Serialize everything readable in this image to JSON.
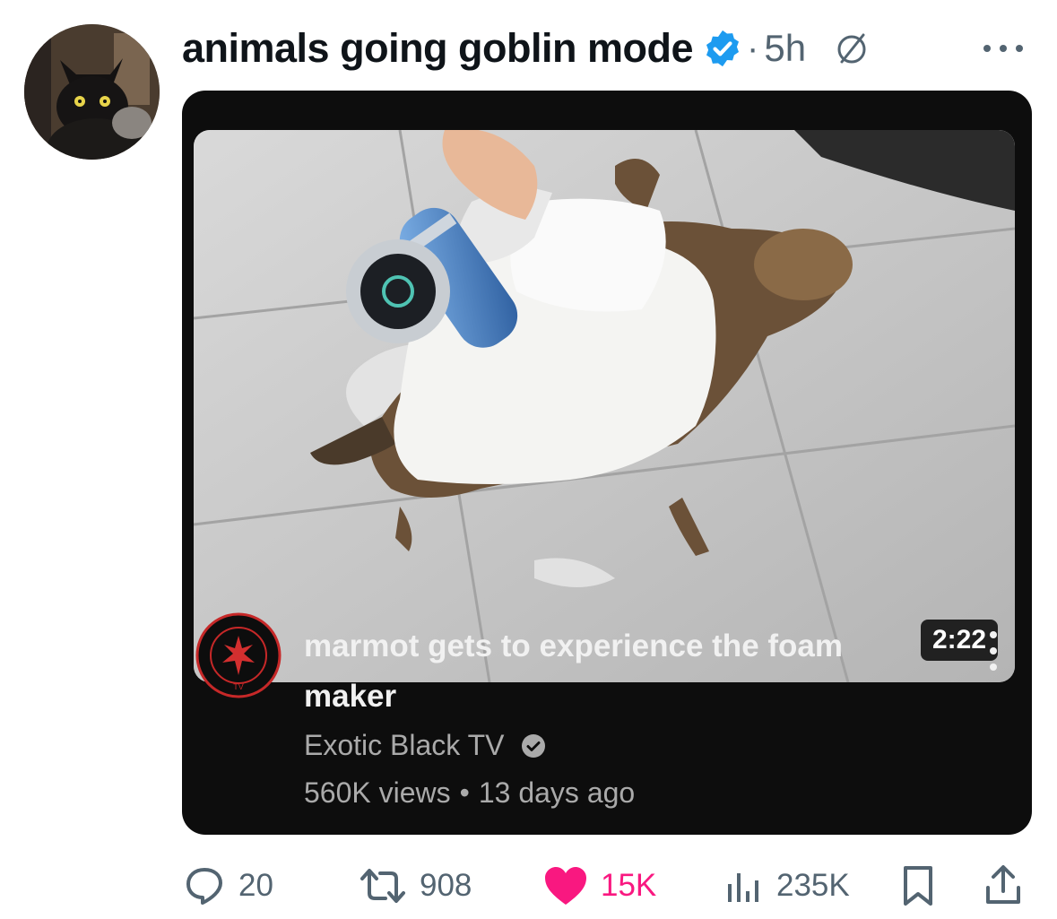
{
  "post": {
    "author_name": "animals going goblin mode",
    "separator": "·",
    "timestamp": "5h"
  },
  "video_card": {
    "duration": "2:22",
    "title": "marmot gets to experience the foam maker",
    "channel_name": "Exotic Black TV",
    "views": "560K views",
    "meta_separator": "•",
    "age": "13 days ago"
  },
  "actions": {
    "replies": "20",
    "reposts": "908",
    "likes": "15K",
    "views": "235K"
  },
  "icons": {
    "verified": "verified-badge-icon",
    "grok": "grok-icon",
    "more": "more-horizontal-icon",
    "reply": "reply-icon",
    "repost": "repost-icon",
    "like": "heart-icon",
    "views": "views-bar-icon",
    "bookmark": "bookmark-icon",
    "share": "share-icon"
  },
  "colors": {
    "verified": "#1d9bf0",
    "like": "#f91880",
    "muted": "#536471",
    "card_background": "#0d0d0d"
  }
}
